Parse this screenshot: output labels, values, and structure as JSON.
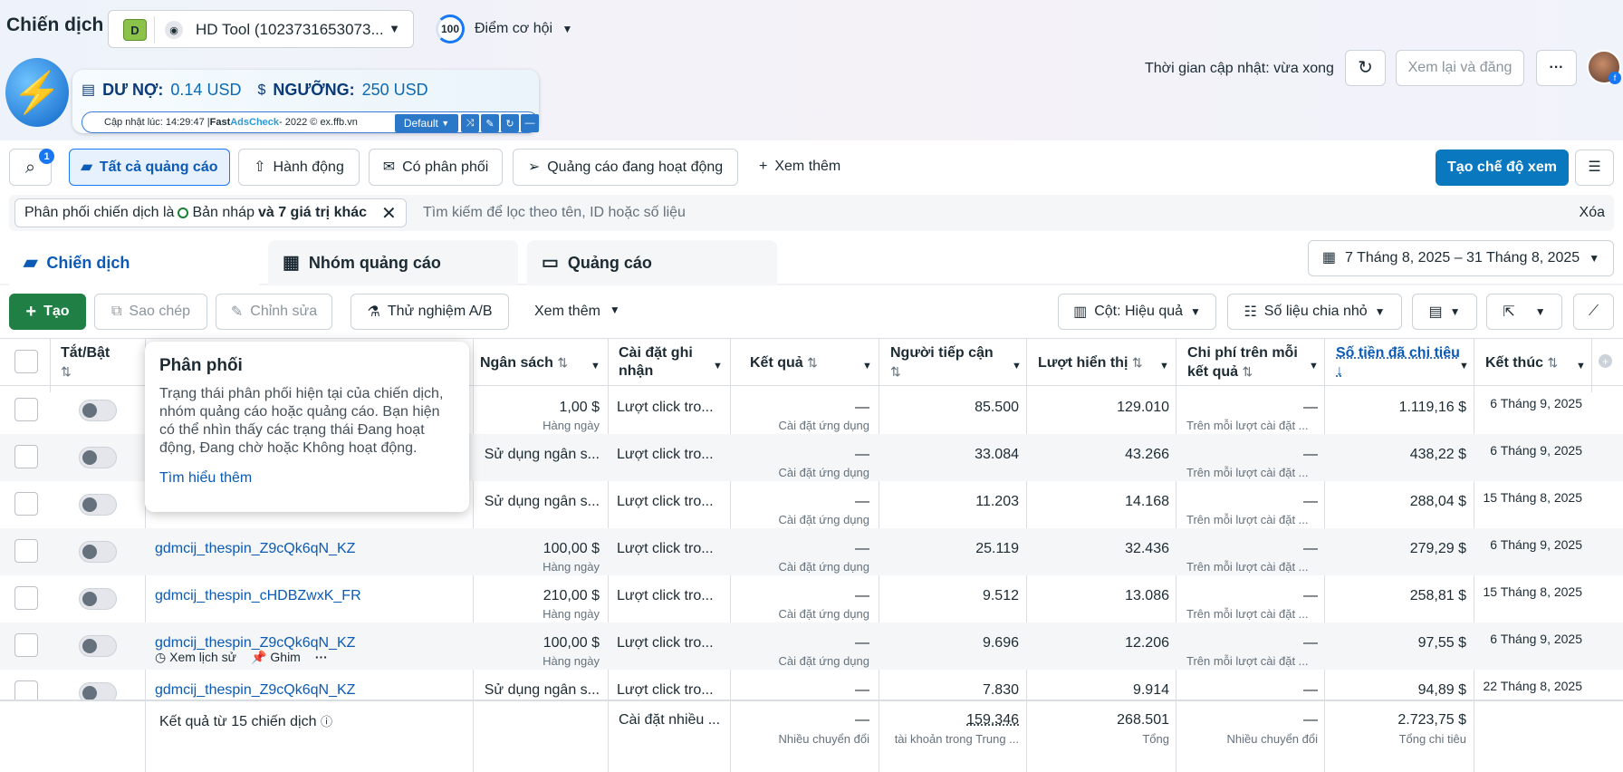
{
  "header": {
    "page_title": "Chiến dịch",
    "account_letter": "D",
    "account_name": "HD Tool (1023731653073...",
    "score_value": "100",
    "score_label": "Điểm cơ hội",
    "update_text": "Thời gian cập nhật: vừa xong",
    "review_publish": "Xem lại và đăng",
    "more": "···"
  },
  "extension": {
    "debt_label": "DƯ NỢ:",
    "debt_value": "0.14 USD",
    "threshold_label": "NGƯỠNG:",
    "threshold_value": "250 USD",
    "update_prefix": "Cập nhật lúc: 14:29:47 | ",
    "fast": "Fast ",
    "adscheck": "AdsCheck",
    "suffix": " - 2022 © ex.ffb.vn",
    "preset": "Default"
  },
  "toolbar": {
    "search_badge": "1",
    "tabs": [
      "Tất cả quảng cáo",
      "Hành động",
      "Có phân phối",
      "Quảng cáo đang hoạt động"
    ],
    "see_more": "Xem thêm",
    "create_view": "Tạo chế độ xem"
  },
  "filter": {
    "chip_prefix": "Phân phối chiến dịch là",
    "chip_value": "Bản nháp",
    "chip_more": "và 7 giá trị khác",
    "search_placeholder": "Tìm kiếm để lọc theo tên, ID hoặc số liệu",
    "clear": "Xóa"
  },
  "level_tabs": [
    "Chiến dịch",
    "Nhóm quảng cáo",
    "Quảng cáo"
  ],
  "date_range": "7 Tháng 8, 2025 – 31 Tháng 8, 2025",
  "actions": {
    "create": "Tạo",
    "copy": "Sao chép",
    "edit": "Chỉnh sửa",
    "ab_test": "Thử nghiệm A/B",
    "see_more": "Xem thêm",
    "columns": "Cột: Hiệu quả",
    "breakdown": "Số liệu chia nhỏ"
  },
  "columns": {
    "toggle": "Tắt/Bật",
    "budget": "Ngân sách",
    "attribution": "Cài đặt ghi nhận",
    "results": "Kết quả",
    "reach": "Người tiếp cận",
    "impressions": "Lượt hiển thị",
    "cost_per_result": "Chi phí trên mỗi kết quả",
    "amount_spent": "Số tiền đã chi tiêu",
    "ends": "Kết thúc"
  },
  "rows": [
    {
      "name": "",
      "budget": "1,00 $",
      "budget_sub": "Hàng ngày",
      "attr": "Lượt click tro...",
      "result": "—",
      "result_sub": "Cài đặt ứng dụng",
      "reach": "85.500",
      "impr": "129.010",
      "cpr": "—",
      "cpr_sub": "Trên mỗi lượt cài đặt ...",
      "spent": "1.119,16 $",
      "end": "6 Tháng 9, 2025"
    },
    {
      "name": "",
      "budget": "Sử dụng ngân s...",
      "budget_sub": "",
      "attr": "Lượt click tro...",
      "result": "—",
      "result_sub": "Cài đặt ứng dụng",
      "reach": "33.084",
      "impr": "43.266",
      "cpr": "—",
      "cpr_sub": "Trên mỗi lượt cài đặt ...",
      "spent": "438,22 $",
      "end": "6 Tháng 9, 2025"
    },
    {
      "name": "",
      "budget": "Sử dụng ngân s...",
      "budget_sub": "",
      "attr": "Lượt click tro...",
      "result": "—",
      "result_sub": "Cài đặt ứng dụng",
      "reach": "11.203",
      "impr": "14.168",
      "cpr": "—",
      "cpr_sub": "Trên mỗi lượt cài đặt ...",
      "spent": "288,04 $",
      "end": "15 Tháng 8, 2025"
    },
    {
      "name": "gdmcij_thespin_Z9cQk6qN_KZ",
      "budget": "100,00 $",
      "budget_sub": "Hàng ngày",
      "attr": "Lượt click tro...",
      "result": "—",
      "result_sub": "Cài đặt ứng dụng",
      "reach": "25.119",
      "impr": "32.436",
      "cpr": "—",
      "cpr_sub": "Trên mỗi lượt cài đặt ...",
      "spent": "279,29 $",
      "end": "6 Tháng 9, 2025"
    },
    {
      "name": "gdmcij_thespin_cHDBZwxK_FR",
      "budget": "210,00 $",
      "budget_sub": "Hàng ngày",
      "attr": "Lượt click tro...",
      "result": "—",
      "result_sub": "Cài đặt ứng dụng",
      "reach": "9.512",
      "impr": "13.086",
      "cpr": "—",
      "cpr_sub": "Trên mỗi lượt cài đặt ...",
      "spent": "258,81 $",
      "end": "15 Tháng 8, 2025"
    },
    {
      "name": "gdmcij_thespin_Z9cQk6qN_KZ",
      "budget": "100,00 $",
      "budget_sub": "Hàng ngày",
      "attr": "Lượt click tro...",
      "result": "—",
      "result_sub": "Cài đặt ứng dụng",
      "reach": "9.696",
      "impr": "12.206",
      "cpr": "—",
      "cpr_sub": "Trên mỗi lượt cài đặt ...",
      "spent": "97,55 $",
      "end": "6 Tháng 9, 2025"
    },
    {
      "name": "gdmcij_thespin_Z9cQk6qN_KZ",
      "budget": "Sử dụng ngân s...",
      "budget_sub": "",
      "attr": "Lượt click tro...",
      "result": "—",
      "result_sub": "",
      "reach": "7.830",
      "impr": "9.914",
      "cpr": "—",
      "cpr_sub": "",
      "spent": "94,89 $",
      "end": "22 Tháng 8, 2025"
    }
  ],
  "row_actions": {
    "history": "Xem lịch sử",
    "pin": "Ghim",
    "more": "···"
  },
  "popover": {
    "title": "Phân phối",
    "body": "Trạng thái phân phối hiện tại của chiến dịch, nhóm quảng cáo hoặc quảng cáo. Bạn hiện có thể nhìn thấy các trạng thái Đang hoạt động, Đang chờ hoặc Không hoạt động.",
    "link": "Tìm hiểu thêm"
  },
  "footer": {
    "summary": "Kết quả từ 15 chiến dịch",
    "attr": "Cài đặt nhiều ...",
    "result": "—",
    "result_sub": "Nhiều chuyển đổi",
    "reach": "159.346",
    "reach_sub": "tài khoản trong Trung ...",
    "impr": "268.501",
    "impr_sub": "Tổng",
    "cpr": "—",
    "cpr_sub": "Nhiều chuyển đổi",
    "spent": "2.723,75 $",
    "spent_sub": "Tổng chi tiêu"
  }
}
